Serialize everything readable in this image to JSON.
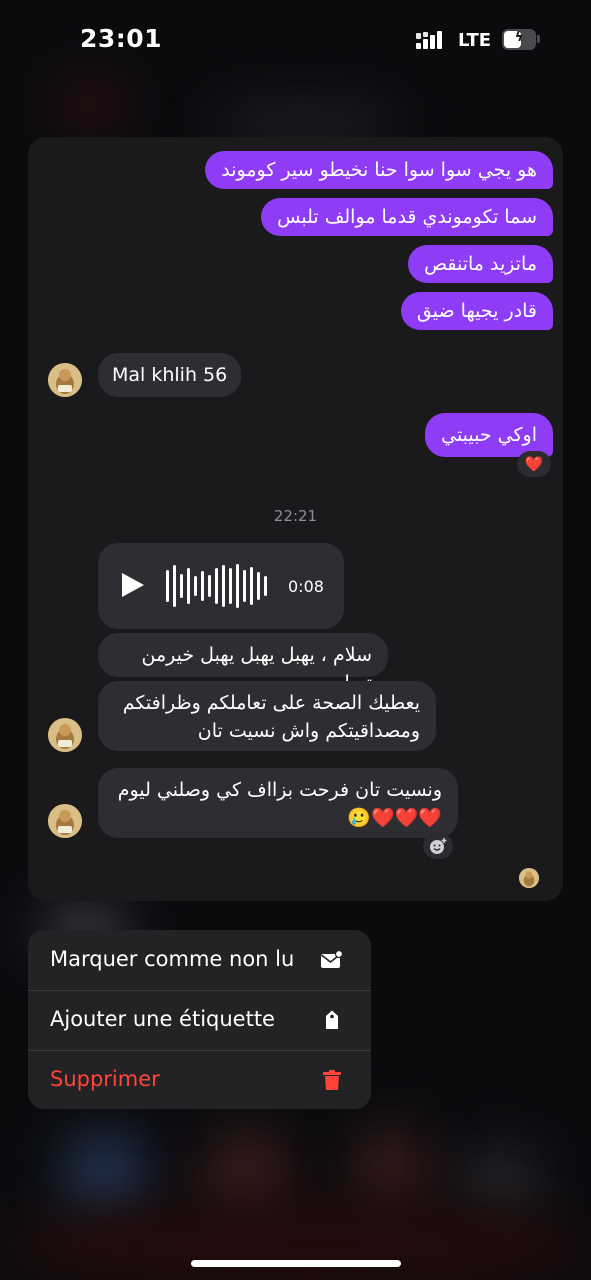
{
  "status_bar": {
    "time": "23:01",
    "network": "LTE",
    "battery_icon": "battery-charging-icon"
  },
  "chat": {
    "outgoing": [
      "هو يجي سوا سوا حنا نخيطو سير كوموند",
      "سما تكوموندي قدما موالف تلبس",
      "ماتزيد ماتنقص",
      "قادر يجيها ضيق"
    ],
    "incoming_1": "Mal khlih 56",
    "outgoing_2": "اوكي حبيبتي",
    "reaction_1": "❤️",
    "timestamp": "22:21",
    "voice_duration": "0:08",
    "incoming_2": "سلام ، يهبل يهبل يهبل خيرمن تصاور",
    "incoming_3_line1": "يعطيك الصحة على تعاملكم وظرافتكم",
    "incoming_3_line2": "ومصداقيتكم  واش نسيت تان",
    "incoming_4_line1": "ونسيت تان  فرحت بزااف كي وصلني ليوم",
    "incoming_4_line2": "❤️❤️❤️🥲"
  },
  "context_menu": {
    "items": [
      {
        "label": "Marquer comme non lu",
        "icon": "envelope-unread-icon"
      },
      {
        "label": "Ajouter une étiquette",
        "icon": "tag-icon"
      },
      {
        "label": "Supprimer",
        "icon": "trash-icon"
      }
    ]
  },
  "colors": {
    "accent": "#8e3cf5",
    "danger": "#ff453a",
    "bubble_in": "#2e2e32",
    "card": "#1a1a1d"
  }
}
